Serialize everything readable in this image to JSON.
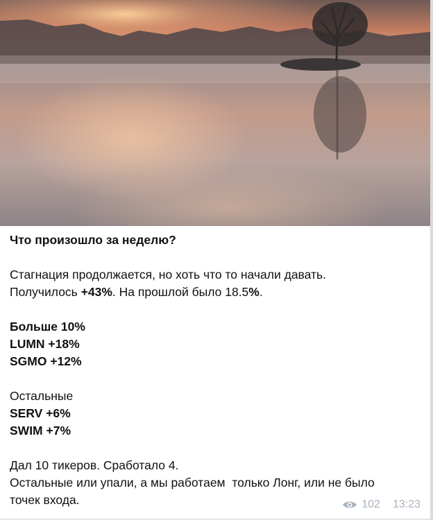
{
  "post": {
    "title": "Что произошло за неделю?",
    "p1_line1": "Стагнация продолжается, но хоть что то начали давать.",
    "p1_line2_a": "Получилось ",
    "p1_line2_b": "+43%",
    "p1_line2_c": ". На прошлой было 18.5",
    "p1_line2_d": "%",
    "p1_line2_e": ".",
    "section1_title": "Больше 10%",
    "section1_items": [
      "LUMN +18%",
      "SGMO +12%"
    ],
    "section2_title": "Остальные",
    "section2_items": [
      "SERV +6%",
      "SWIM +7%"
    ],
    "p3_line1": "Дал 10 тикеров. Сработало 4.",
    "p3_line2": "Остальные или упали, а мы работаем  только Лонг, или не было",
    "p3_line3": "точек входа."
  },
  "meta": {
    "views": "102",
    "time": "13:23",
    "views_icon": "eye-icon"
  },
  "colors": {
    "meta_text": "#a8b3bd",
    "text": "#111111",
    "background": "#ffffff"
  }
}
